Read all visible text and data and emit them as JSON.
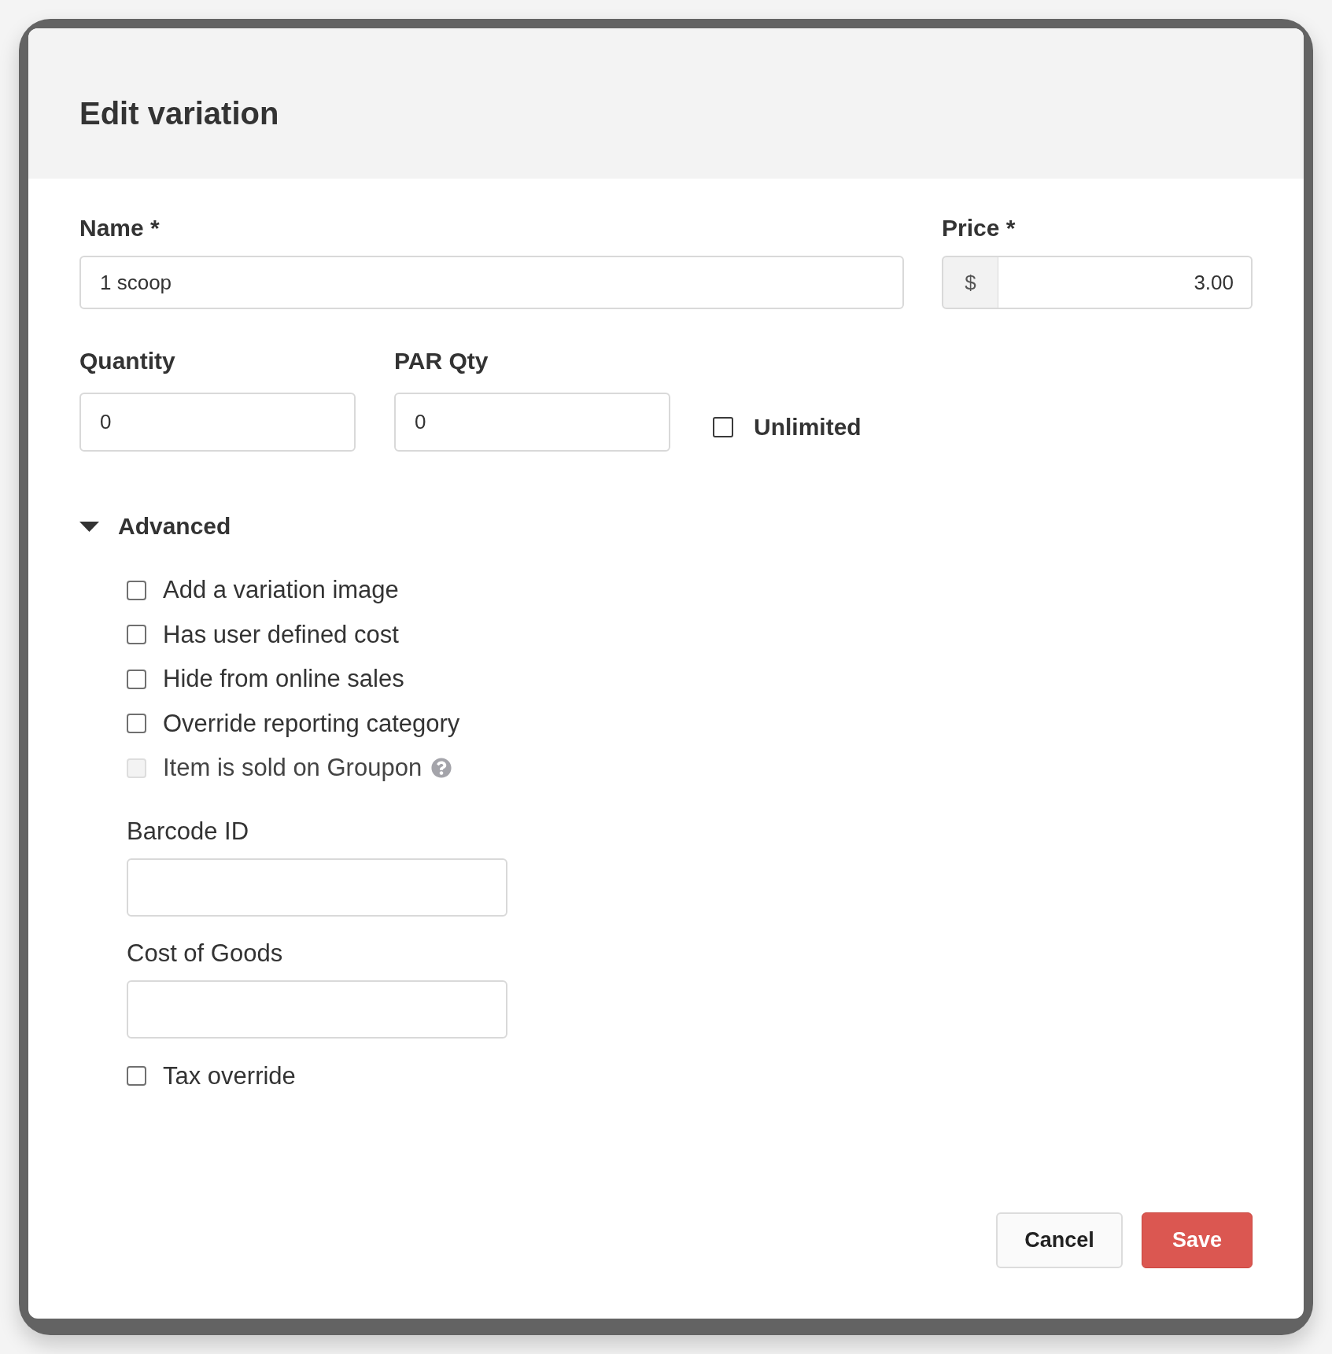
{
  "dialog": {
    "title": "Edit variation"
  },
  "name": {
    "label": "Name *",
    "value": "1 scoop"
  },
  "price": {
    "label": "Price *",
    "prefix": "$",
    "value": "3.00"
  },
  "stock": {
    "quantity": {
      "label": "Quantity",
      "value": "0"
    },
    "par_qty": {
      "label": "PAR Qty",
      "value": "0"
    },
    "unlimited": {
      "label": "Unlimited",
      "checked": false
    }
  },
  "advanced": {
    "label": "Advanced",
    "expanded": true,
    "items": [
      {
        "kind": "checkbox",
        "label": "Add a variation image",
        "checked": false,
        "disabled": false,
        "help": false
      },
      {
        "kind": "checkbox",
        "label": "Has user defined cost",
        "checked": false,
        "disabled": false,
        "help": false
      },
      {
        "kind": "checkbox",
        "label": "Hide from online sales",
        "checked": false,
        "disabled": false,
        "help": false
      },
      {
        "kind": "checkbox",
        "label": "Override reporting category",
        "checked": false,
        "disabled": false,
        "help": false
      },
      {
        "kind": "checkbox",
        "label": "Item is sold on Groupon",
        "checked": false,
        "disabled": true,
        "help": true
      },
      {
        "kind": "text_field",
        "label": "Barcode ID"
      },
      {
        "kind": "text_field",
        "label": "Cost of Goods"
      },
      {
        "kind": "checkbox",
        "label": "Tax override",
        "checked": false,
        "disabled": false,
        "help": false
      }
    ]
  },
  "buttons": [
    {
      "label": "Cancel",
      "kind": "secondary"
    },
    {
      "label": "Save",
      "kind": "primary"
    }
  ]
}
